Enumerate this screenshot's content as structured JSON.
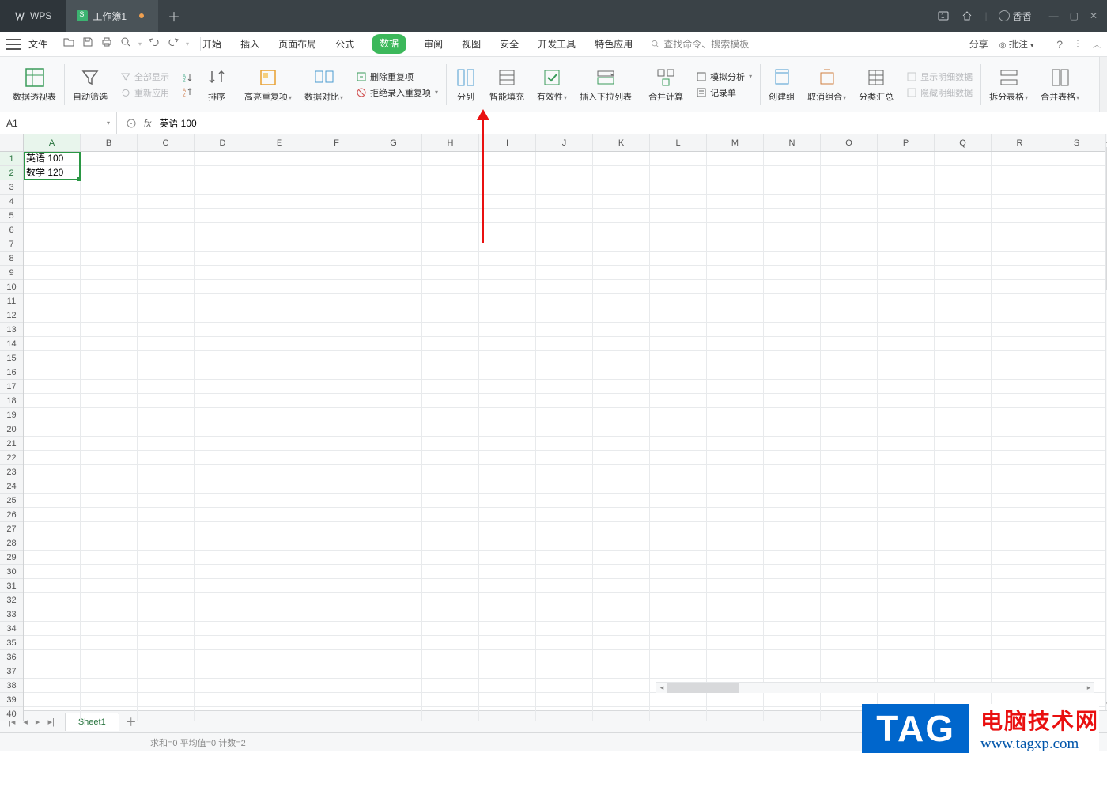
{
  "app": {
    "brand": "WPS",
    "doc_title": "工作簿1",
    "user": "香香"
  },
  "window_controls": {
    "min": "—",
    "max": "▢",
    "close": "✕"
  },
  "quick_access": {
    "file": "文件"
  },
  "menu": {
    "tabs": [
      "开始",
      "插入",
      "页面布局",
      "公式",
      "数据",
      "审阅",
      "视图",
      "安全",
      "开发工具",
      "特色应用"
    ],
    "active_index": 4,
    "search_placeholder": "查找命令、搜索模板",
    "share": "分享",
    "annotate": "批注"
  },
  "ribbon": {
    "pivot": "数据透视表",
    "autofilter": "自动筛选",
    "show_all": "全部显示",
    "reapply": "重新应用",
    "sort": "排序",
    "highlight_dup": "高亮重复项",
    "compare": "数据对比",
    "remove_dup": "删除重复项",
    "reject_dup": "拒绝录入重复项",
    "text_to_col": "分列",
    "smart_fill": "智能填充",
    "validation": "有效性",
    "dropdown_list": "插入下拉列表",
    "consolidate": "合并计算",
    "what_if": "模拟分析",
    "record_form": "记录单",
    "group": "创建组",
    "ungroup": "取消组合",
    "subtotal": "分类汇总",
    "show_detail": "显示明细数据",
    "hide_detail": "隐藏明细数据",
    "split_tables": "拆分表格",
    "merge_tables": "合并表格"
  },
  "namebox": {
    "ref": "A1",
    "formula": "英语 100"
  },
  "columns": [
    "A",
    "B",
    "C",
    "D",
    "E",
    "F",
    "G",
    "H",
    "I",
    "J",
    "K",
    "L",
    "M",
    "N",
    "O",
    "P",
    "Q",
    "R",
    "S"
  ],
  "rows_visible": 40,
  "cells": {
    "A1": "英语 100",
    "A2": "数学 120"
  },
  "sheet_tab": {
    "name": "Sheet1"
  },
  "status": {
    "text": "求和=0  平均值=0  计数=2"
  },
  "watermark": {
    "tag": "TAG",
    "cn": "电脑技术网",
    "url": "www.tagxp.com"
  }
}
